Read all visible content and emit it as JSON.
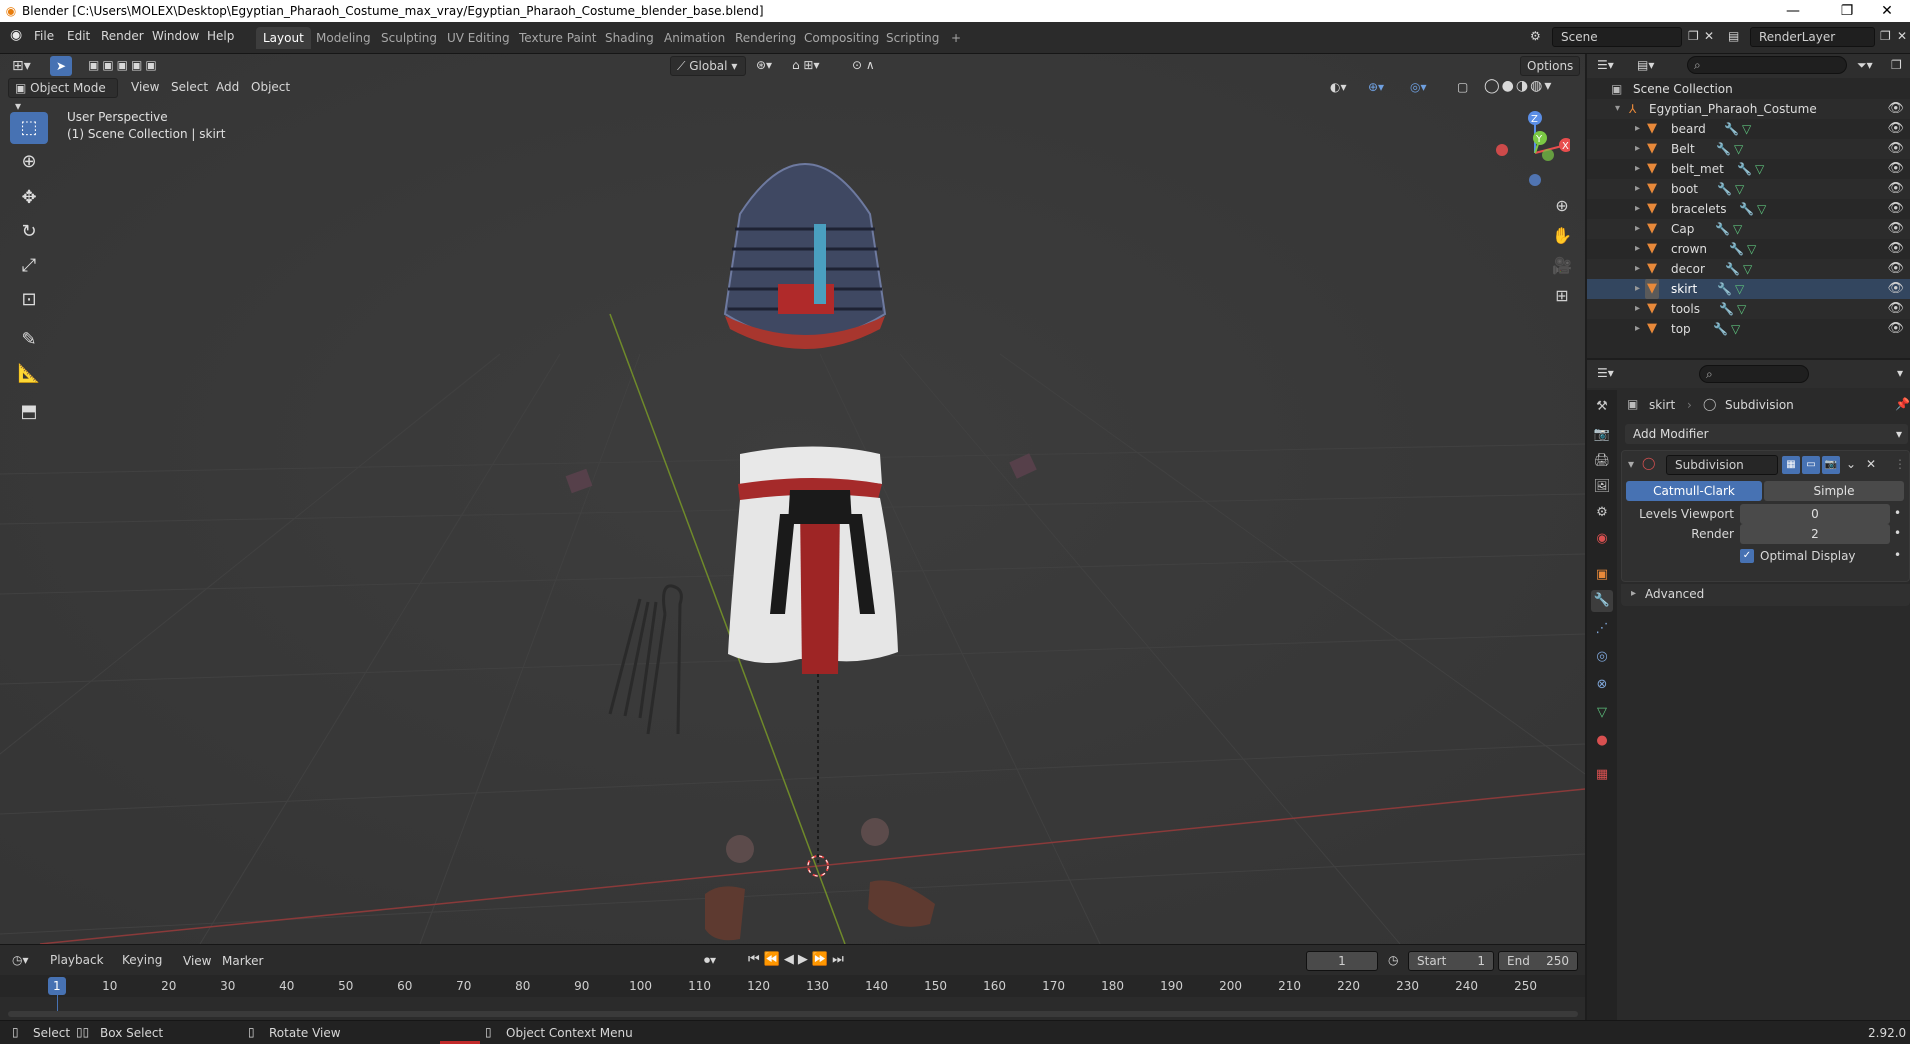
{
  "window": {
    "title": "Blender [C:\\Users\\MOLEX\\Desktop\\Egyptian_Pharaoh_Costume_max_vray/Egyptian_Pharaoh_Costume_blender_base.blend]",
    "minimize": "—",
    "maximize": "❐",
    "close": "✕"
  },
  "menu": {
    "file": "File",
    "edit": "Edit",
    "render": "Render",
    "window": "Window",
    "help": "Help"
  },
  "workspaces": [
    "Layout",
    "Modeling",
    "Sculpting",
    "UV Editing",
    "Texture Paint",
    "Shading",
    "Animation",
    "Rendering",
    "Compositing",
    "Scripting"
  ],
  "workspace_add": "+",
  "scene": {
    "name": "Scene",
    "render_layer": "RenderLayer"
  },
  "viewport": {
    "mode": "Object Mode",
    "menus": [
      "View",
      "Select",
      "Add",
      "Object"
    ],
    "transform_orientation": "Global",
    "options": "Options",
    "perspective": "User Perspective",
    "collection_info": "(1) Scene Collection | skirt",
    "gizmo": {
      "z": "Z",
      "y": "Y",
      "x": "X"
    }
  },
  "outliner": {
    "root": "Scene Collection",
    "collection": "Egyptian_Pharaoh_Costume",
    "objects": [
      "beard",
      "Belt",
      "belt_met",
      "boot",
      "bracelets",
      "Cap",
      "crown",
      "decor",
      "skirt",
      "tools",
      "top"
    ],
    "selected": "skirt"
  },
  "properties": {
    "object": "skirt",
    "modifier_crumb": "Subdivision",
    "add_modifier": "Add Modifier",
    "modifier_name": "Subdivision",
    "catmull": "Catmull-Clark",
    "simple": "Simple",
    "levels_viewport_label": "Levels Viewport",
    "levels_viewport_value": "0",
    "render_label": "Render",
    "render_value": "2",
    "optimal_display": "Optimal Display",
    "advanced": "Advanced"
  },
  "timeline": {
    "menus": [
      "Playback",
      "Keying",
      "View",
      "Marker"
    ],
    "current_frame": "1",
    "start_label": "Start",
    "start": "1",
    "end_label": "End",
    "end": "250",
    "ticks": [
      "1",
      "10",
      "20",
      "30",
      "40",
      "50",
      "60",
      "70",
      "80",
      "90",
      "100",
      "110",
      "120",
      "130",
      "140",
      "150",
      "160",
      "170",
      "180",
      "190",
      "200",
      "210",
      "220",
      "230",
      "240",
      "250"
    ]
  },
  "status": {
    "select": "Select",
    "box_select": "Box Select",
    "rotate_view": "Rotate View",
    "context_menu": "Object Context Menu",
    "version": "2.92.0"
  }
}
